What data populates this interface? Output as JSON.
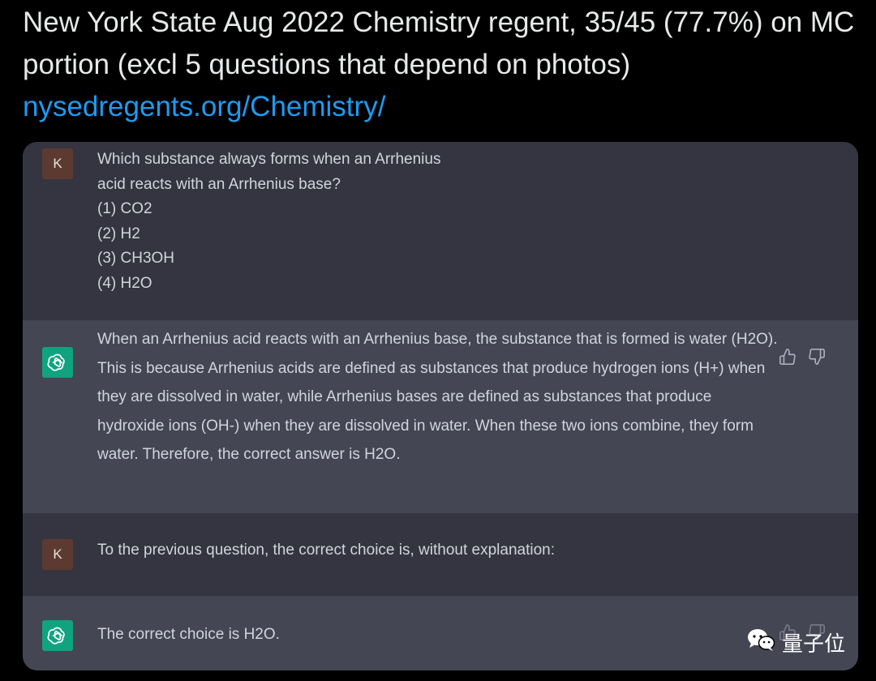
{
  "tweet": {
    "text": "New York State Aug 2022 Chemistry regent, 35/45 (77.7%) on MC portion (excl 5 questions that depend on photos) ",
    "link": "nysedregents.org/Chemistry/"
  },
  "chat": {
    "messages": [
      {
        "role": "user",
        "avatar_letter": "K",
        "text": "Which substance always forms when an Arrhenius\nacid reacts with an Arrhenius base?\n(1) CO2\n(2) H2\n(3) CH3OH\n(4) H2O"
      },
      {
        "role": "assistant",
        "avatar_icon": "openai-logo-icon",
        "text": "When an Arrhenius acid reacts with an Arrhenius base, the substance that is formed is water (H2O). This is because Arrhenius acids are defined as substances that produce hydrogen ions (H+) when they are dissolved in water, while Arrhenius bases are defined as substances that produce hydroxide ions (OH-) when they are dissolved in water. When these two ions combine, they form water. Therefore, the correct answer is H2O."
      },
      {
        "role": "user",
        "avatar_letter": "K",
        "text": "To the previous question, the correct choice is, without explanation:"
      },
      {
        "role": "assistant",
        "avatar_icon": "openai-logo-icon",
        "text": "The correct choice is H2O."
      }
    ]
  },
  "watermark": {
    "text": "量子位",
    "icon": "wechat-icon"
  },
  "colors": {
    "background": "#000000",
    "tweet_text": "#e7e9ea",
    "link": "#1d9bf0",
    "user_bg": "#343541",
    "assistant_bg": "#444654",
    "gpt_green": "#10a37f",
    "user_avatar": "#5c3a32"
  }
}
